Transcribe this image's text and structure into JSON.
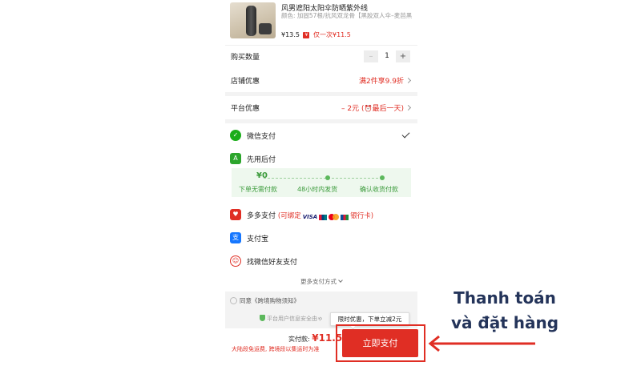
{
  "product": {
    "title": "风男遮阳太阳伞防晒紫外线",
    "spec": "颜色: 加固57根/抗风双龙骨【黑胶双人伞–麦芭黑",
    "price": "¥13.5",
    "price_tag": "¥",
    "once_label": "仅一次¥11.5"
  },
  "quantity": {
    "label": "购买数量",
    "minus": "–",
    "value": "1",
    "plus": "+"
  },
  "store_discount": {
    "label": "店铺优惠",
    "value": "满2件享9.9折"
  },
  "platform_discount": {
    "label": "平台优惠",
    "value_prefix": "– 2元 (",
    "value_suffix": "最后一天)"
  },
  "payment_methods": [
    {
      "label": "微信支付",
      "icon": "wechat-pay-icon",
      "color": "#1aad19"
    },
    {
      "label": "先用后付",
      "icon": "pay-later-icon",
      "color": "#2ca52c"
    },
    {
      "label": "多多支付",
      "icon": "heart-pay-icon",
      "color": "#e02e24",
      "hint_open": "(可绑定",
      "hint_close": "银行卡)",
      "card_brands": [
        "VISA"
      ]
    },
    {
      "label": "支付宝",
      "icon": "alipay-icon",
      "color": "#1677ff"
    },
    {
      "label": "找微信好友支付",
      "icon": "friends-icon",
      "color": "#e02e24"
    }
  ],
  "bnpl": {
    "amount": "¥0",
    "steps": [
      "下单无需付款",
      "48小时内发货",
      "确认收货付款"
    ]
  },
  "more_payment": "更多支付方式",
  "agreement": "同意《跨境购物须知》",
  "security_note": "平台用户信息安全由ゃ",
  "tooltip": "限时优惠，下单立减2元",
  "total": {
    "label": "实付款: ",
    "amount": "¥11.5"
  },
  "shipping_note": "大陆段免运费, 跨境段以集运时为准",
  "pay_button": "立即支付",
  "caption": {
    "line1": "Thanh toán",
    "line2": "và đặt hàng"
  },
  "colors": {
    "accent": "#e02e24",
    "caption": "#24345a",
    "green": "#5cb85c"
  }
}
